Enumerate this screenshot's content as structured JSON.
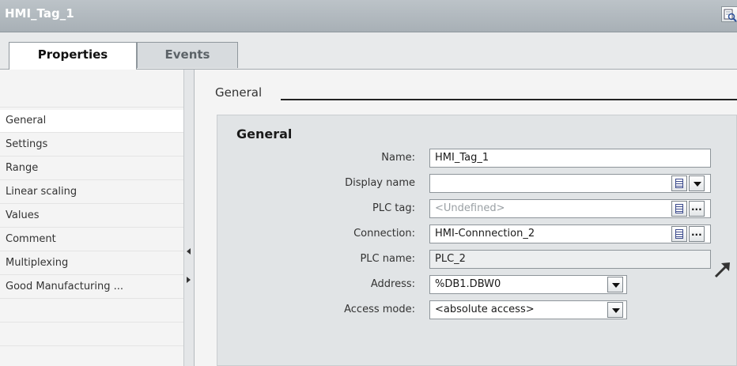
{
  "window": {
    "title": "HMI_Tag_1",
    "inspect_icon": "zoom-page-icon"
  },
  "tabs": [
    {
      "label": "Properties",
      "active": true
    },
    {
      "label": "Events",
      "active": false
    }
  ],
  "nav": {
    "items": [
      {
        "label": "General",
        "selected": true
      },
      {
        "label": "Settings"
      },
      {
        "label": "Range"
      },
      {
        "label": "Linear scaling"
      },
      {
        "label": "Values"
      },
      {
        "label": "Comment"
      },
      {
        "label": "Multiplexing"
      },
      {
        "label": "Good Manufacturing ..."
      }
    ]
  },
  "section": {
    "header": "General",
    "panel_title": "General"
  },
  "form": {
    "name": {
      "label": "Name:",
      "value": "HMI_Tag_1"
    },
    "display_name": {
      "label": "Display name",
      "value": ""
    },
    "plc_tag": {
      "label": "PLC tag:",
      "placeholder": "<Undefined>"
    },
    "connection": {
      "label": "Connection:",
      "value": "HMI-Connnection_2"
    },
    "plc_name": {
      "label": "PLC name:",
      "value": "PLC_2"
    },
    "address": {
      "label": "Address:",
      "value": "%DB1.DBW0"
    },
    "access_mode": {
      "label": "Access mode:",
      "value": "<absolute access>"
    }
  },
  "colors": {
    "titlebar": "#a8b0b6",
    "panel": "#e1e4e6",
    "field_border": "#8e959a"
  }
}
